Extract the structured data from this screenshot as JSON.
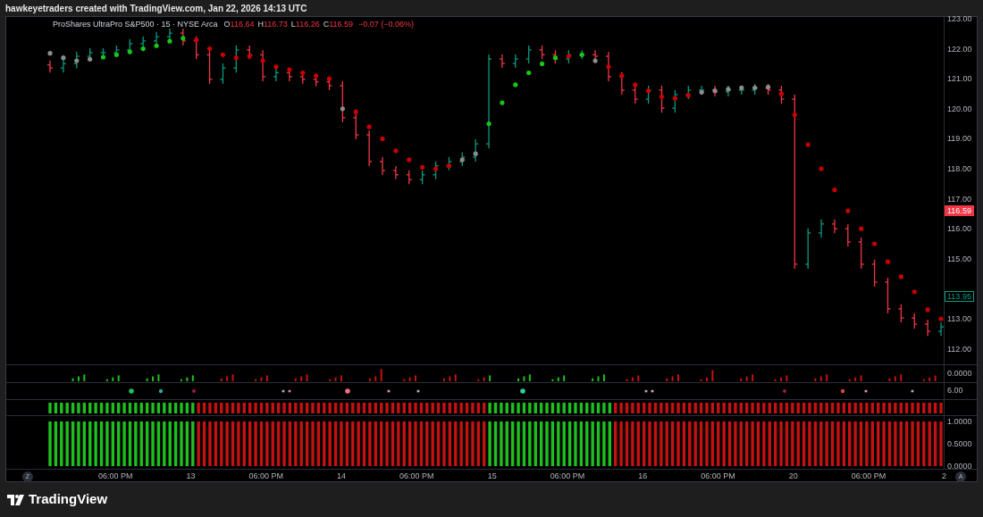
{
  "header": {
    "text": "hawkeyetraders created with TradingView.com, Jan 22, 2026 14:13 UTC"
  },
  "legend": {
    "symbol": "ProShares UltraPro S&P500 · 15 · NYSE Arca",
    "ohlc": [
      {
        "label": "O",
        "value": "116.64"
      },
      {
        "label": "H",
        "value": "116.73"
      },
      {
        "label": "L",
        "value": "116.26"
      },
      {
        "label": "C",
        "value": "116.59"
      }
    ],
    "change": "−0.07 (−0.06%)"
  },
  "price_axis": [
    {
      "kind": "tick",
      "label": "123.00"
    },
    {
      "kind": "tick",
      "label": "122.00"
    },
    {
      "kind": "tick",
      "label": "121.00"
    },
    {
      "kind": "tick",
      "label": "120.00"
    },
    {
      "kind": "tick",
      "label": "119.00"
    },
    {
      "kind": "tick",
      "label": "118.00"
    },
    {
      "kind": "tick",
      "label": "117.00"
    },
    {
      "kind": "last",
      "label": "116.59"
    },
    {
      "kind": "tick",
      "label": "116.00"
    },
    {
      "kind": "tick",
      "label": "115.00"
    },
    {
      "kind": "line",
      "label": "113.95"
    },
    {
      "kind": "tick",
      "label": "113.00"
    },
    {
      "kind": "tick",
      "label": "112.00"
    }
  ],
  "panes": [
    {
      "kind": "volume",
      "axis_label": "0.0000"
    },
    {
      "kind": "signals",
      "axis_label": "6.00"
    },
    {
      "kind": "strip"
    }
  ],
  "oscillator": {
    "chart_data": {
      "type": "bar",
      "stacked": true,
      "ylim": [
        0,
        1
      ],
      "yticks": [
        {
          "value": 1,
          "label": "1.0000"
        },
        {
          "value": 0.5,
          "label": "0.5000"
        },
        {
          "value": 0,
          "label": "0.0000"
        }
      ],
      "series": [
        {
          "color": "#1fbf1f",
          "values": [
            1,
            1,
            1,
            1,
            1,
            1,
            1,
            1,
            1,
            1,
            1,
            1,
            1,
            1,
            1,
            1,
            1,
            1,
            1,
            1,
            1,
            1,
            1,
            1,
            1,
            1,
            null,
            null,
            null,
            null,
            null,
            null,
            null,
            null,
            null,
            null,
            null,
            null,
            null,
            null,
            null,
            null,
            null,
            null,
            null,
            null,
            null,
            null,
            null,
            null,
            null,
            null,
            null,
            null,
            null,
            null,
            null,
            null,
            null,
            null,
            null,
            null,
            null,
            null,
            null,
            null,
            null,
            null,
            null,
            null,
            null,
            null,
            null,
            null,
            null,
            null,
            null,
            1,
            1,
            1,
            1,
            1,
            1,
            1,
            1,
            1,
            1,
            1,
            1,
            1,
            1,
            1,
            1,
            1,
            1,
            1,
            1,
            1,
            1,
            null,
            null,
            null,
            null,
            null,
            null,
            null,
            null,
            null,
            null,
            null,
            null,
            null,
            null,
            null,
            null,
            null,
            null,
            null,
            null,
            null,
            null,
            null,
            null,
            null,
            null,
            null,
            null,
            null,
            null,
            null,
            null,
            null,
            null,
            null,
            null,
            null,
            null,
            null,
            null,
            null,
            null,
            null,
            null,
            null,
            null,
            null,
            null,
            null,
            null,
            null,
            null,
            null,
            null,
            null,
            null,
            null,
            null
          ]
        },
        {
          "color": "#c41212",
          "values": [
            null,
            null,
            null,
            null,
            null,
            null,
            null,
            null,
            null,
            null,
            null,
            null,
            null,
            null,
            null,
            null,
            null,
            null,
            null,
            null,
            null,
            null,
            null,
            null,
            null,
            null,
            1,
            1,
            1,
            1,
            1,
            1,
            1,
            1,
            1,
            1,
            1,
            1,
            1,
            1,
            1,
            1,
            1,
            1,
            1,
            1,
            1,
            1,
            1,
            1,
            1,
            1,
            1,
            1,
            1,
            1,
            1,
            1,
            1,
            1,
            1,
            1,
            1,
            1,
            1,
            1,
            1,
            1,
            1,
            1,
            1,
            1,
            1,
            1,
            1,
            1,
            1,
            null,
            null,
            null,
            null,
            null,
            null,
            null,
            null,
            null,
            null,
            null,
            null,
            null,
            null,
            null,
            null,
            null,
            null,
            null,
            null,
            null,
            null,
            1,
            1,
            1,
            1,
            1,
            1,
            1,
            1,
            1,
            1,
            1,
            1,
            1,
            1,
            1,
            1,
            1,
            1,
            1,
            1,
            1,
            1,
            1,
            1,
            1,
            1,
            1,
            1,
            1,
            1,
            1,
            1,
            1,
            1,
            1,
            1,
            1,
            1,
            1,
            1,
            1,
            1,
            1,
            1,
            1,
            1,
            1,
            1,
            1,
            1,
            1,
            1,
            1,
            1,
            1,
            1,
            1,
            1
          ]
        }
      ]
    }
  },
  "time_axis": [
    "06:00 PM",
    "13",
    "06:00 PM",
    "14",
    "06:00 PM",
    "15",
    "06:00 PM",
    "16",
    "06:00 PM",
    "20",
    "06:00 PM",
    "2"
  ],
  "buttons": {
    "left": "Z",
    "right": "A"
  },
  "footer": {
    "brand": "TradingView"
  }
}
